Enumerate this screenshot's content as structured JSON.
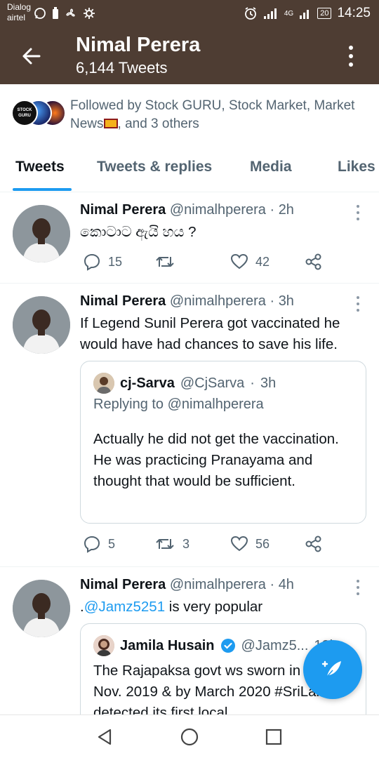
{
  "status_bar": {
    "carrier_line1": "Dialog",
    "carrier_line2": "airtel",
    "network": "4G",
    "battery": "20",
    "time": "14:25"
  },
  "header": {
    "title": "Nimal Perera",
    "subtitle": "6,144 Tweets"
  },
  "followed_by": {
    "avatar1_text": "STOCK GURU",
    "text_before_flag": "Followed by Stock GURU, Stock Market, Market News",
    "text_after_flag": ", and 3 others"
  },
  "tabs": [
    {
      "label": "Tweets",
      "active": true
    },
    {
      "label": "Tweets & replies",
      "active": false
    },
    {
      "label": "Media",
      "active": false
    },
    {
      "label": "Likes",
      "active": false
    }
  ],
  "tweets": [
    {
      "name": "Nimal Perera",
      "handle": "@nimalhperera",
      "time": "2h",
      "text": "කොටාට ඇයි හය ?",
      "replies": "15",
      "retweets": "",
      "likes": "42"
    },
    {
      "name": "Nimal Perera",
      "handle": "@nimalhperera",
      "time": "3h",
      "text": "If Legend Sunil Perera got vaccinated he would have had chances to save his life.",
      "quote": {
        "name": "cj-Sarva",
        "handle": "@CjSarva",
        "time": "3h",
        "replying_to": "Replying to @nimalhperera",
        "text": "Actually he did not get the vaccination. He was practicing Pranayama and thought that would be sufficient."
      },
      "replies": "5",
      "retweets": "3",
      "likes": "56"
    },
    {
      "name": "Nimal Perera",
      "handle": "@nimalhperera",
      "time": "4h",
      "text_prefix": ".",
      "mention": "@Jamz5251",
      "text_suffix": " is very popular",
      "quote": {
        "name": "Jamila Husain",
        "handle": "@Jamz5...",
        "time": "12h",
        "text": "The Rajapaksa govt ws sworn in power in Nov. 2019 & by March 2020 #SriLanka detected its first local"
      }
    }
  ],
  "colors": {
    "header_bg": "#4e3d33",
    "accent": "#1d9bf0",
    "text_primary": "#0f1419",
    "text_secondary": "#536471"
  }
}
